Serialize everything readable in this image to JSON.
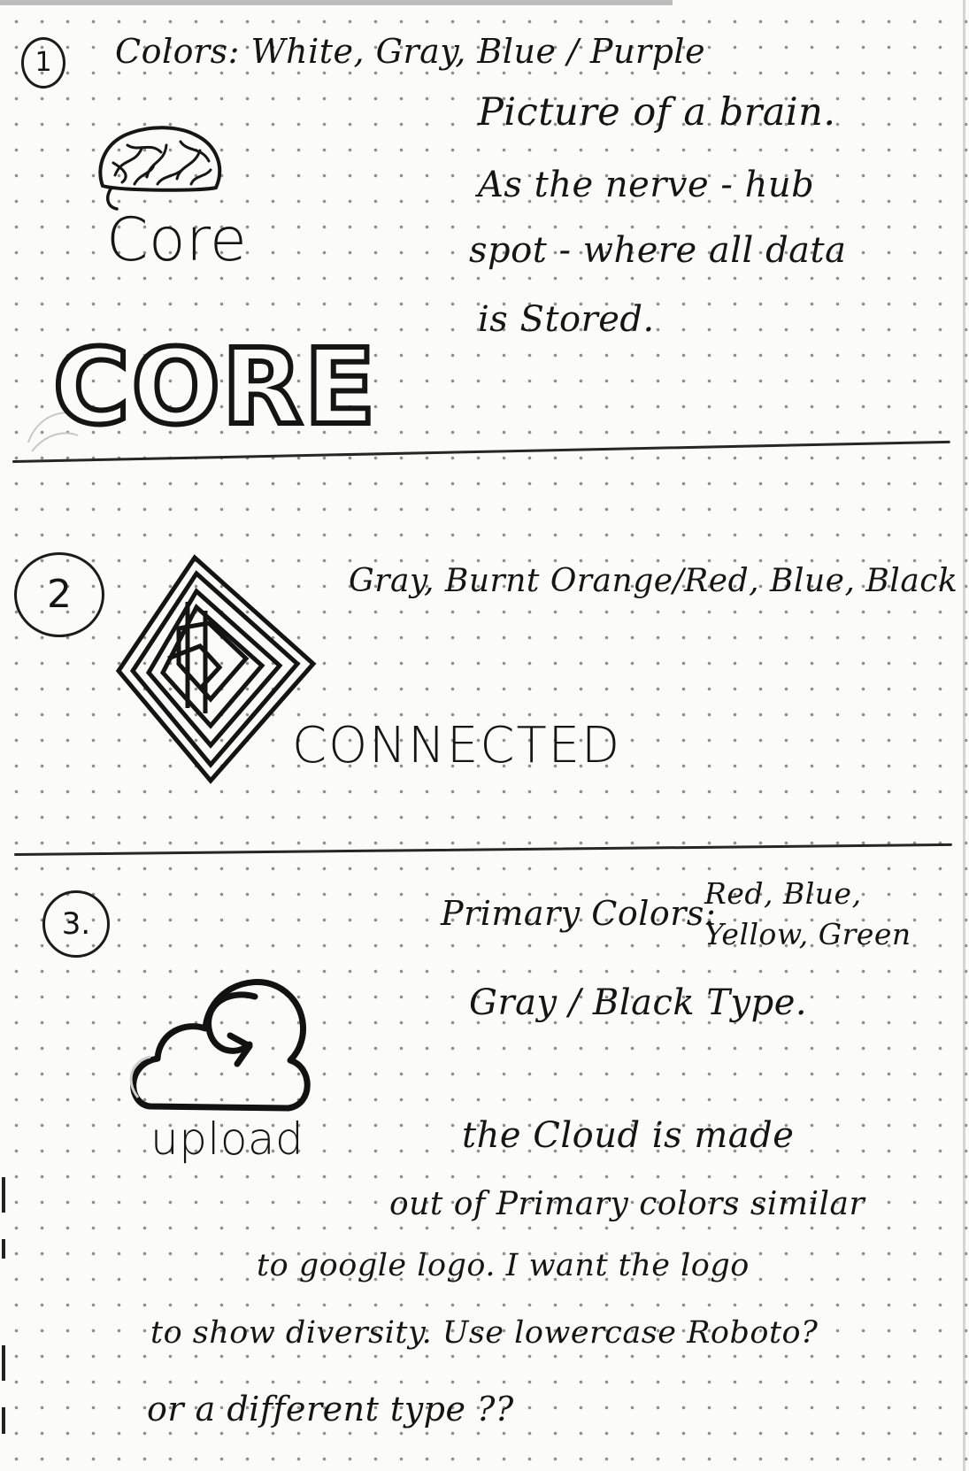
{
  "section1": {
    "number": "1",
    "colors_line": "Colors: White, Gray, Blue / Purple",
    "note_lines": [
      "Picture of a brain.",
      "As the nerve - hub",
      "spot - where all data",
      "is Stored."
    ],
    "logo_small": "Core",
    "logo_large": "CORE"
  },
  "section2": {
    "number": "2",
    "colors_line": "Gray, Burnt Orange/Red, Blue, Black",
    "logo_text": "CONNECTED"
  },
  "section3": {
    "number": "3.",
    "colors_line1": "Primary Colors:",
    "colors_line2a": "Red, Blue,",
    "colors_line2b": "Yellow, Green",
    "type_line": "Gray / Black Type.",
    "logo_text": "upload",
    "note_lines": [
      "the Cloud is made",
      "out of Primary colors similar",
      "to google logo. I want the logo",
      "to show diversity. Use lowercase Roboto?",
      "or a different type ??"
    ]
  }
}
